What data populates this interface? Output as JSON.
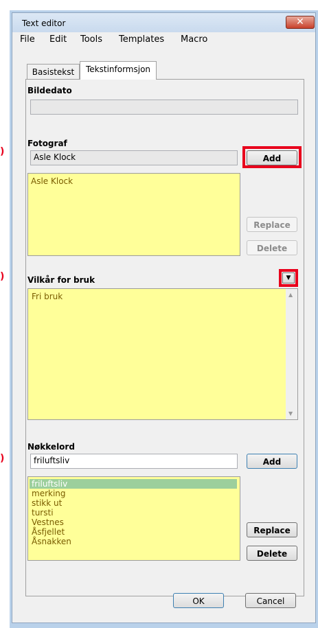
{
  "window": {
    "title": "Text editor",
    "close_glyph": "✕"
  },
  "menu": [
    "File",
    "Edit",
    "Tools",
    "Templates",
    "Macro"
  ],
  "tabs": [
    {
      "label": "Basistekst",
      "active": false
    },
    {
      "label": "Tekstinformsjon",
      "active": true
    }
  ],
  "bildedato": {
    "label": "Bildedato",
    "value": ""
  },
  "fotograf": {
    "label": "Fotograf",
    "value": "Asle Klock",
    "add_label": "Add",
    "list": [
      "Asle Klock"
    ],
    "replace_label": "Replace",
    "delete_label": "Delete"
  },
  "vilkar": {
    "label": "Vilkår for bruk",
    "text": "Fri bruk",
    "dropdown_icon": "chevron-down-icon"
  },
  "nokkelord": {
    "label": "Nøkkelord",
    "value": "friluftsliv",
    "add_label": "Add",
    "list": [
      "friluftsliv",
      "merking",
      "stikk ut",
      "tursti",
      "Vestnes",
      "Åsfjellet",
      "Åsnakken"
    ],
    "replace_label": "Replace",
    "delete_label": "Delete"
  },
  "footer": {
    "ok_label": "OK",
    "cancel_label": "Cancel"
  },
  "side_marks": [
    ")",
    ")",
    ")"
  ],
  "colors": {
    "highlight": "#e8001c",
    "list_bg": "#ffff99",
    "selected_row": "#9ccf9c"
  }
}
